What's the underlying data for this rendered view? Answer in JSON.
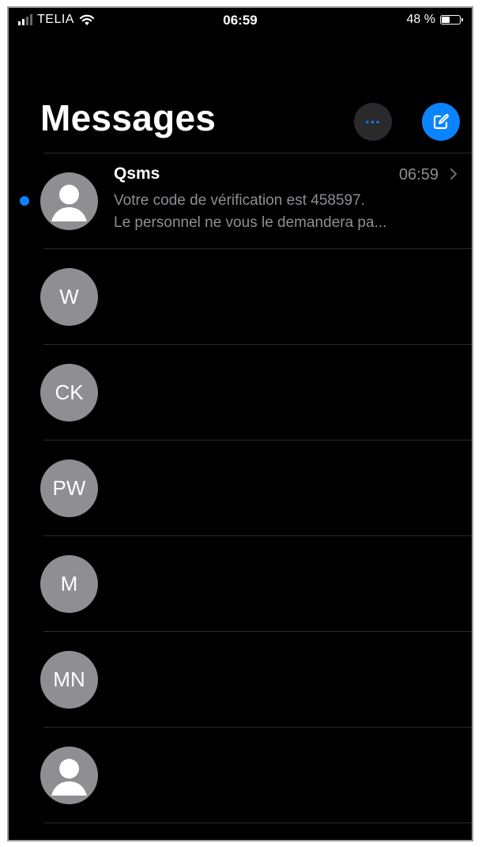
{
  "status_bar": {
    "carrier": "TELIA",
    "time": "06:59",
    "battery_percent_label": "48 %",
    "battery_level": 0.48
  },
  "header": {
    "title": "Messages",
    "more_icon": "ellipsis-icon",
    "compose_icon": "compose-icon"
  },
  "conversations": [
    {
      "sender": "Qsms",
      "time": "06:59",
      "preview_line1": "Votre code de vérification est 458597.",
      "preview_line2": "Le personnel ne vous le demandera pa...",
      "unread": true,
      "avatar_type": "person-icon"
    },
    {
      "initials": "W",
      "avatar_type": "initials"
    },
    {
      "initials": "CK",
      "avatar_type": "initials"
    },
    {
      "initials": "PW",
      "avatar_type": "initials"
    },
    {
      "initials": "M",
      "avatar_type": "initials"
    },
    {
      "initials": "MN",
      "avatar_type": "initials"
    },
    {
      "avatar_type": "person-icon"
    }
  ],
  "colors": {
    "background": "#000000",
    "accent": "#0a84ff",
    "avatar": "#8e8e93",
    "secondary_text": "#8e8e93"
  }
}
